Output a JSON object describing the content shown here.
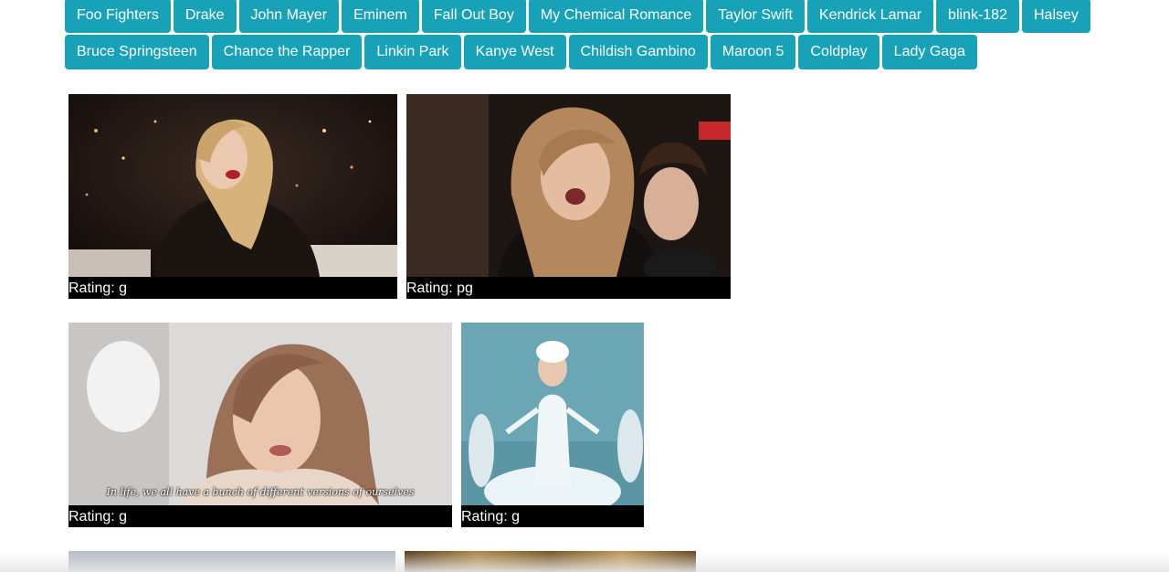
{
  "artists": [
    "Foo Fighters",
    "Drake",
    "John Mayer",
    "Eminem",
    "Fall Out Boy",
    "My Chemical Romance",
    "Taylor Swift",
    "Kendrick Lamar",
    "blink-182",
    "Halsey",
    "Bruce Springsteen",
    "Chance the Rapper",
    "Linkin Park",
    "Kanye West",
    "Childish Gambino",
    "Maroon 5",
    "Coldplay",
    "Lady Gaga"
  ],
  "gifs": [
    {
      "rating": "Rating: g",
      "caption": ""
    },
    {
      "rating": "Rating: pg",
      "caption": ""
    },
    {
      "rating": "Rating: g",
      "caption": "In life, we all have a bunch of different versions of ourselves"
    },
    {
      "rating": "Rating: g",
      "caption": ""
    }
  ],
  "colors": {
    "button": "#17a2b8",
    "rating_bar": "#000000"
  }
}
